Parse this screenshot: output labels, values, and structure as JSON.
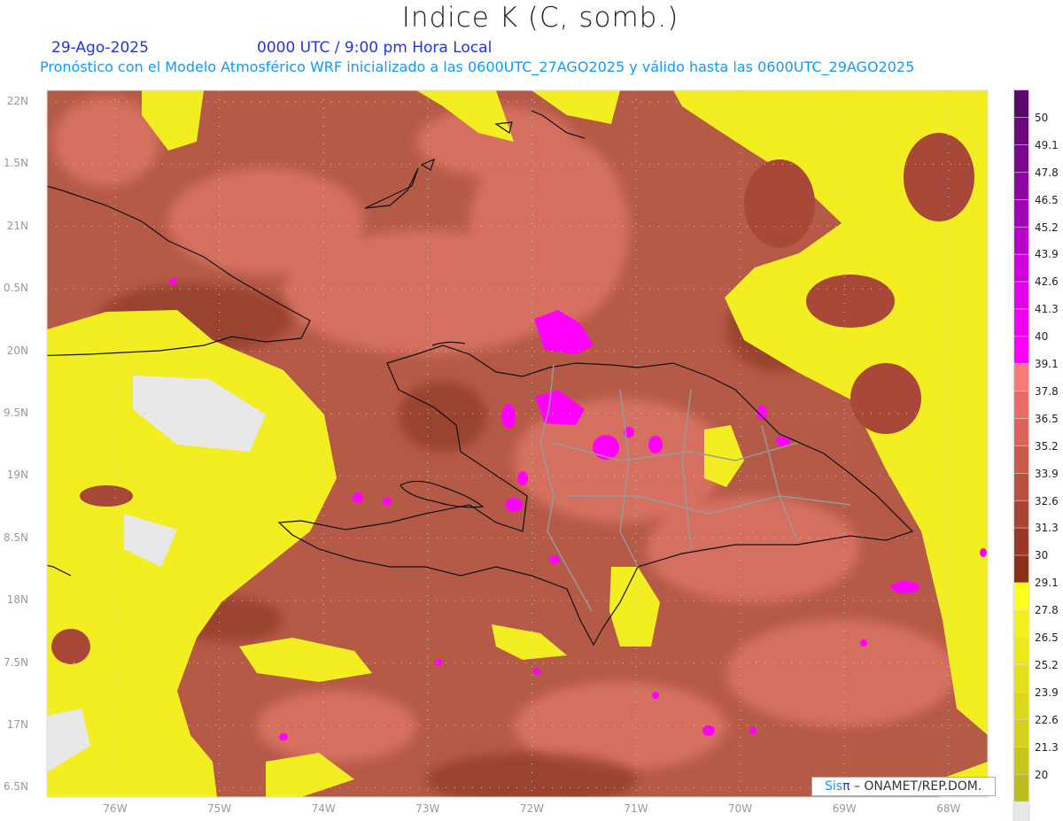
{
  "header": {
    "title": "Indice K (C, somb.)",
    "date": "29-Ago-2025",
    "time": "0000 UTC / 9:00 pm Hora Local",
    "subtitle": "Pronóstico con el Modelo Atmosférico WRF inicializado a las 0600UTC_27AGO2025 y válido hasta las  0600UTC_29AGO2025"
  },
  "axes": {
    "lat_labels": [
      "22N",
      "1.5N",
      "21N",
      "0.5N",
      "20N",
      "9.5N",
      "19N",
      "8.5N",
      "18N",
      "7.5N",
      "17N",
      "6.5N"
    ],
    "lon_labels": [
      "76W",
      "75W",
      "74W",
      "73W",
      "72W",
      "71W",
      "70W",
      "69W",
      "68W"
    ]
  },
  "colorbar": {
    "labels": [
      "50",
      "49.1",
      "47.8",
      "46.5",
      "45.2",
      "43.9",
      "42.6",
      "41.3",
      "40",
      "39.1",
      "37.8",
      "36.5",
      "35.2",
      "33.9",
      "32.6",
      "31.3",
      "30",
      "29.1",
      "27.8",
      "26.5",
      "25.2",
      "23.9",
      "22.6",
      "21.3",
      "20"
    ],
    "colors": [
      "#5a0a6a",
      "#6a0a7c",
      "#78088c",
      "#8c06a2",
      "#a004b6",
      "#b802ca",
      "#d000dc",
      "#e400ea",
      "#f000f2",
      "#ff00ff",
      "#f87a78",
      "#e86c64",
      "#dc645a",
      "#c85a4c",
      "#b8503f",
      "#a84434",
      "#983828",
      "#8a3018",
      "#ffff1e",
      "#f4f020",
      "#ece81c",
      "#e4e01c",
      "#dcd81c",
      "#d4d01e",
      "#c8c41e",
      "#bcbc1e",
      "#e8e8e8"
    ]
  },
  "credit": {
    "brand_a": "Sis",
    "brand_b": "π",
    "rest": " –  ONAMET/REP.DOM."
  }
}
